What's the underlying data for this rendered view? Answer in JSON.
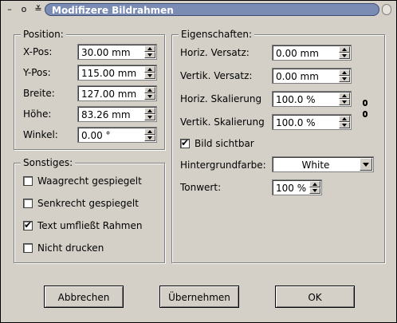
{
  "window": {
    "title": "Modifizere Bildrahmen",
    "controls": {
      "minimize_glyph": "–",
      "restore_glyph": "o",
      "shade_glyph": "≚"
    }
  },
  "position": {
    "legend": "Position:",
    "fields": [
      {
        "label": "X-Pos:",
        "value": "30.00 mm"
      },
      {
        "label": "Y-Pos:",
        "value": "115.00 mm"
      },
      {
        "label": "Breite:",
        "value": "127.00 mm"
      },
      {
        "label": "Höhe:",
        "value": "83.26 mm"
      },
      {
        "label": "Winkel:",
        "value": "0.00 °"
      }
    ]
  },
  "sonstiges": {
    "legend": "Sonstiges:",
    "checks": [
      {
        "label": "Waagrecht gespiegelt",
        "checked": false,
        "mark": ""
      },
      {
        "label": "Senkrecht gespiegelt",
        "checked": false,
        "mark": ""
      },
      {
        "label": "Text umfließt Rahmen",
        "checked": true,
        "mark": "✔"
      },
      {
        "label": "Nicht drucken",
        "checked": false,
        "mark": ""
      }
    ]
  },
  "eigenschaften": {
    "legend": "Eigenschaften:",
    "fields": [
      {
        "label": "Horiz. Versatz:",
        "value": "0.00 mm"
      },
      {
        "label": "Vertik. Versatz:",
        "value": "0.00 mm"
      },
      {
        "label": "Horiz. Skalierung",
        "value": "100.0 %"
      },
      {
        "label": "Vertik. Skalierung",
        "value": "100.0 %"
      }
    ],
    "bild_sichtbar": {
      "label": "Bild sichtbar",
      "checked": true,
      "mark": "✔"
    },
    "hintergrundfarbe": {
      "label": "Hintergrundfarbe:",
      "value": "White"
    },
    "tonwert": {
      "label": "Tonwert:",
      "value": "100 %"
    }
  },
  "buttons": {
    "cancel": "Abbrechen",
    "apply": "Übernehmen",
    "ok": "OK"
  }
}
